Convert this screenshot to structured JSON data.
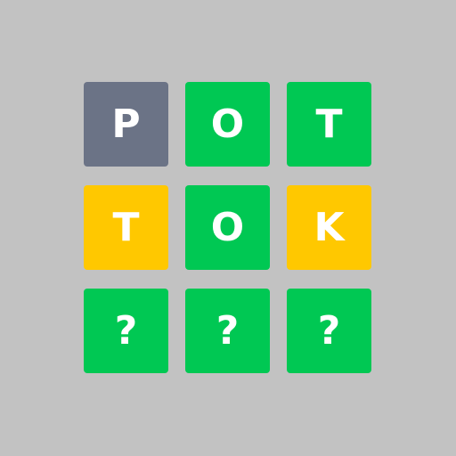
{
  "board": {
    "rows": [
      {
        "tiles": [
          {
            "letter": "P",
            "state": "absent",
            "color": "#6b7386"
          },
          {
            "letter": "O",
            "state": "correct",
            "color": "#00c853"
          },
          {
            "letter": "T",
            "state": "correct",
            "color": "#00c853"
          }
        ]
      },
      {
        "tiles": [
          {
            "letter": "T",
            "state": "present",
            "color": "#ffc800"
          },
          {
            "letter": "O",
            "state": "correct",
            "color": "#00c853"
          },
          {
            "letter": "K",
            "state": "present",
            "color": "#ffc800"
          }
        ]
      },
      {
        "tiles": [
          {
            "letter": "?",
            "state": "correct",
            "color": "#00c853"
          },
          {
            "letter": "?",
            "state": "correct",
            "color": "#00c853"
          },
          {
            "letter": "?",
            "state": "correct",
            "color": "#00c853"
          }
        ]
      }
    ]
  },
  "colors": {
    "background": "#c2c2c2",
    "absent": "#6b7386",
    "correct": "#00c853",
    "present": "#ffc800",
    "text": "#ffffff"
  }
}
